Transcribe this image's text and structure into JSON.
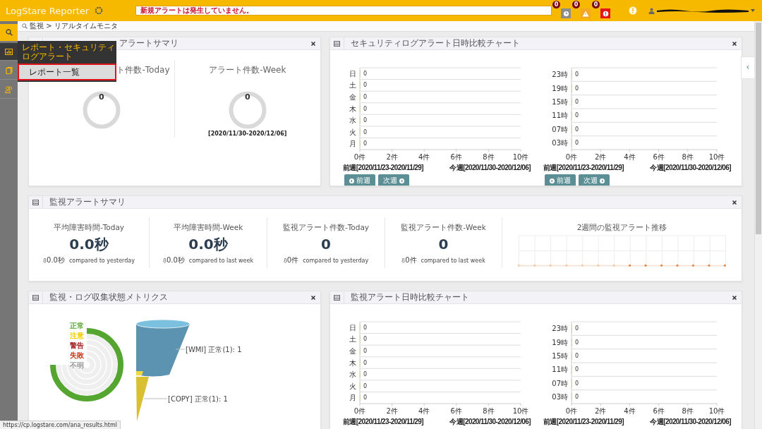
{
  "header": {
    "logo": "LogStare Reporter",
    "notice": "新規アラートは発生していません。",
    "alerts": [
      {
        "kind": "clock",
        "count": "0",
        "color": "#8c8c8c"
      },
      {
        "kind": "warning",
        "count": "0",
        "color": "#f5a623"
      },
      {
        "kind": "error",
        "count": "0",
        "color": "#e8141c"
      }
    ]
  },
  "sidebar": {
    "items": [
      {
        "kind": "search",
        "selected": true,
        "expanded": false
      },
      {
        "kind": "report",
        "selected": false,
        "expanded": true
      },
      {
        "kind": "book",
        "selected": false,
        "expanded": false
      },
      {
        "kind": "users",
        "selected": false,
        "expanded": false
      }
    ]
  },
  "flyout": {
    "title": "レポート・セキュリティログアラート",
    "items": [
      {
        "label": "レポート一覧",
        "selected": true
      }
    ]
  },
  "breadcrumb": "監視 > リアルタイムモニタ",
  "panels": [
    {
      "kind": "alert_summary",
      "title": "アラートサマリ",
      "stats": [
        {
          "title": "ト件数-Today",
          "value": "0"
        },
        {
          "title": "アラート件数-Week",
          "value": "0",
          "range": "[2020/11/30-2020/12/06]"
        }
      ]
    },
    {
      "kind": "compare",
      "title": "セキュリティログアラート日時比較チャート",
      "charts": [
        {
          "chart_data": {
            "type": "bar",
            "orientation": "horizontal",
            "categories": [
              "日",
              "土",
              "金",
              "木",
              "水",
              "火",
              "月"
            ],
            "values": [
              0,
              0,
              0,
              0,
              0,
              0,
              0
            ],
            "xlim": [
              0,
              10
            ],
            "xticks": [
              {
                "value": 0,
                "label": "0件"
              },
              {
                "value": 2,
                "label": "2件"
              },
              {
                "value": 4,
                "label": "4件"
              },
              {
                "value": 6,
                "label": "6件"
              },
              {
                "value": 8,
                "label": "8件"
              },
              {
                "value": 10,
                "label": "10件"
              }
            ],
            "data_labels": true
          },
          "prev_week": "前週[2020/11/23-2020/11/29]",
          "this_week": "今週[2020/11/30-2020/12/06]",
          "buttons": [
            {
              "kind": "prev",
              "label": "前週"
            },
            {
              "kind": "next",
              "label": "次週"
            }
          ]
        },
        {
          "chart_data": {
            "type": "bar",
            "orientation": "horizontal",
            "categories": [
              "23時",
              "19時",
              "15時",
              "11時",
              "07時",
              "03時"
            ],
            "values": [
              0,
              0,
              0,
              0,
              0,
              0
            ],
            "xlim": [
              0,
              10
            ],
            "xticks": [
              {
                "value": 0,
                "label": "0件"
              },
              {
                "value": 2,
                "label": "2件"
              },
              {
                "value": 4,
                "label": "4件"
              },
              {
                "value": 6,
                "label": "6件"
              },
              {
                "value": 8,
                "label": "8件"
              },
              {
                "value": 10,
                "label": "10件"
              }
            ],
            "data_labels": true
          },
          "prev_week": "前週[2020/11/23-2020/11/29]",
          "this_week": "今週[2020/11/30-2020/12/06]",
          "buttons": [
            {
              "kind": "prev",
              "label": "前週"
            },
            {
              "kind": "next",
              "label": "次週"
            }
          ]
        }
      ]
    },
    {
      "kind": "monitor_summary",
      "title": "監視アラートサマリ",
      "stats": [
        {
          "title": "平均障害時間-Today",
          "value": "0.0秒",
          "delta": "0.0秒",
          "compare": "compared to yesterday"
        },
        {
          "title": "平均障害時間-Week",
          "value": "0.0秒",
          "delta": "0.0秒",
          "compare": "compared to last week"
        },
        {
          "title": "監視アラート件数-Today",
          "value": "0",
          "delta": "0件",
          "compare": "compared to yesterday"
        },
        {
          "title": "監視アラート件数-Week",
          "value": "0",
          "delta": "0件",
          "compare": "compared to last week"
        }
      ],
      "trend": {
        "title": "2週間の監視アラート推移"
      }
    },
    {
      "kind": "metrics",
      "title": "監視・ログ収集状態メトリクス",
      "legend": [
        {
          "label": "正常",
          "color": "#55a630"
        },
        {
          "label": "注意",
          "color": "#f0d000"
        },
        {
          "label": "警告",
          "color": "#a02828"
        },
        {
          "label": "失敗",
          "color": "#c83010"
        },
        {
          "label": "不明",
          "color": "#999999"
        }
      ],
      "funnel": [
        {
          "label": "[WMI] 正常(1): 1",
          "color": "#5b93b0"
        },
        {
          "label": "[COPY] 正常(1): 1",
          "color": "#d8c030"
        }
      ]
    },
    {
      "kind": "compare",
      "title": "監視アラート日時比較チャート",
      "charts": [
        {
          "chart_data": {
            "type": "bar",
            "orientation": "horizontal",
            "categories": [
              "日",
              "土",
              "金",
              "木",
              "水",
              "火",
              "月"
            ],
            "values": [
              0,
              0,
              0,
              0,
              0,
              0,
              0
            ],
            "xlim": [
              0,
              10
            ],
            "xticks": [
              {
                "value": 0,
                "label": "0件"
              },
              {
                "value": 2,
                "label": "2件"
              },
              {
                "value": 4,
                "label": "4件"
              },
              {
                "value": 6,
                "label": "6件"
              },
              {
                "value": 8,
                "label": "8件"
              },
              {
                "value": 10,
                "label": "10件"
              }
            ],
            "data_labels": true
          },
          "prev_week": "前週[2020/11/23-2020/11/29]",
          "this_week": "今週[2020/11/30-2020/12/06]"
        },
        {
          "chart_data": {
            "type": "bar",
            "orientation": "horizontal",
            "categories": [
              "23時",
              "19時",
              "15時",
              "11時",
              "07時",
              "03時"
            ],
            "values": [
              0,
              0,
              0,
              0,
              0,
              0
            ],
            "xlim": [
              0,
              10
            ],
            "xticks": [
              {
                "value": 0,
                "label": "0件"
              },
              {
                "value": 2,
                "label": "2件"
              },
              {
                "value": 4,
                "label": "4件"
              },
              {
                "value": 6,
                "label": "6件"
              },
              {
                "value": 8,
                "label": "8件"
              },
              {
                "value": 10,
                "label": "10件"
              }
            ],
            "data_labels": true
          },
          "prev_week": "前週[2020/11/23-2020/11/29]",
          "this_week": "今週[2020/11/30-2020/12/06]"
        }
      ]
    }
  ],
  "side_toggle": "‹",
  "status_url": "https://cp.logstare.com/ana_results.html"
}
